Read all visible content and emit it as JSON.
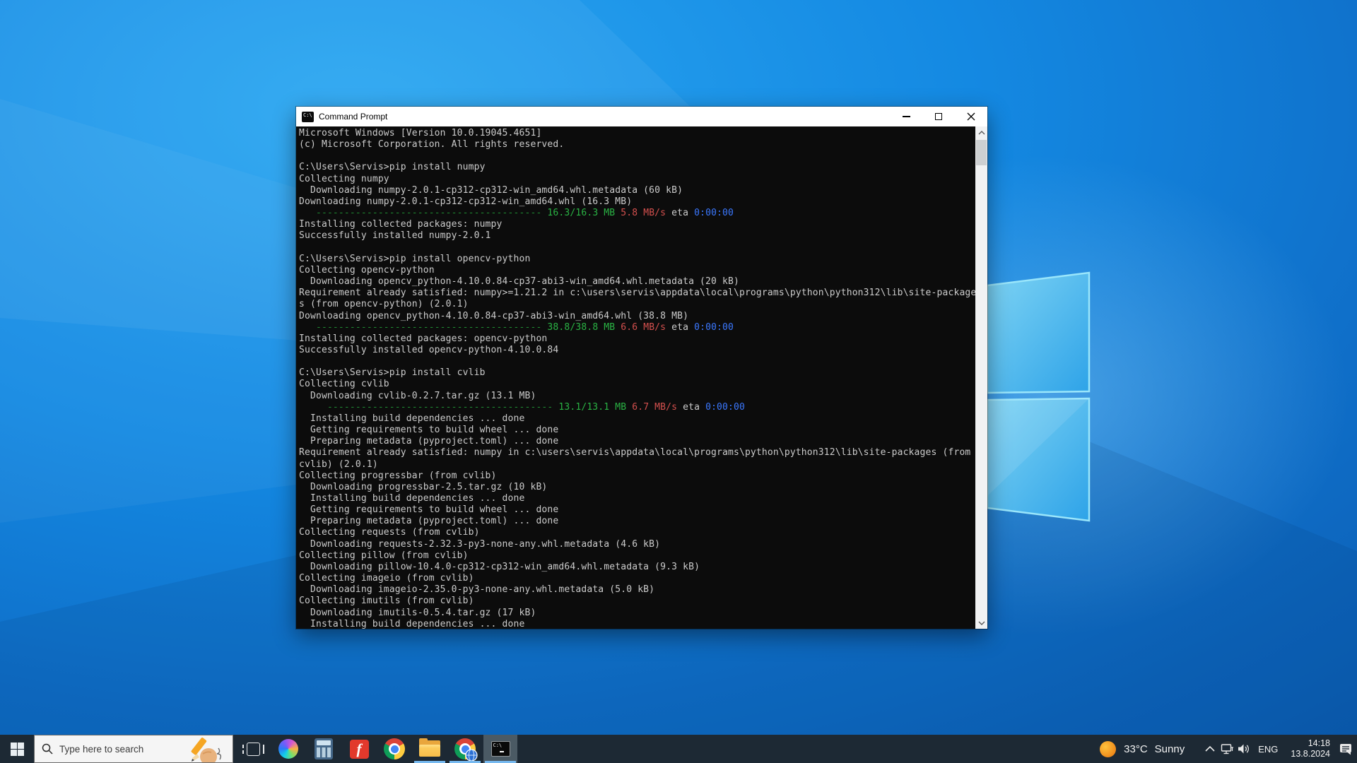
{
  "window": {
    "title": "Command Prompt",
    "icon_label": "C:\\"
  },
  "terminal": {
    "lines": [
      "Microsoft Windows [Version 10.0.19045.4651]",
      "(c) Microsoft Corporation. All rights reserved.",
      "",
      "C:\\Users\\Servis>pip install numpy",
      "Collecting numpy",
      "  Downloading numpy-2.0.1-cp312-cp312-win_amd64.whl.metadata (60 kB)",
      "Downloading numpy-2.0.1-cp312-cp312-win_amd64.whl (16.3 MB)",
      [
        {
          "t": "   ",
          "c": "d"
        },
        {
          "t": "---------------------------------------- ",
          "c": "gd"
        },
        {
          "t": "16.3/16.3 MB",
          "c": "g"
        },
        {
          "t": " ",
          "c": "d"
        },
        {
          "t": "5.8 MB/s",
          "c": "r"
        },
        {
          "t": " eta ",
          "c": "d"
        },
        {
          "t": "0:00:00",
          "c": "b"
        }
      ],
      "Installing collected packages: numpy",
      "Successfully installed numpy-2.0.1",
      "",
      "C:\\Users\\Servis>pip install opencv-python",
      "Collecting opencv-python",
      "  Downloading opencv_python-4.10.0.84-cp37-abi3-win_amd64.whl.metadata (20 kB)",
      "Requirement already satisfied: numpy>=1.21.2 in c:\\users\\servis\\appdata\\local\\programs\\python\\python312\\lib\\site-package",
      "s (from opencv-python) (2.0.1)",
      "Downloading opencv_python-4.10.0.84-cp37-abi3-win_amd64.whl (38.8 MB)",
      [
        {
          "t": "   ",
          "c": "d"
        },
        {
          "t": "---------------------------------------- ",
          "c": "gd"
        },
        {
          "t": "38.8/38.8 MB",
          "c": "g"
        },
        {
          "t": " ",
          "c": "d"
        },
        {
          "t": "6.6 MB/s",
          "c": "r"
        },
        {
          "t": " eta ",
          "c": "d"
        },
        {
          "t": "0:00:00",
          "c": "b"
        }
      ],
      "Installing collected packages: opencv-python",
      "Successfully installed opencv-python-4.10.0.84",
      "",
      "C:\\Users\\Servis>pip install cvlib",
      "Collecting cvlib",
      "  Downloading cvlib-0.2.7.tar.gz (13.1 MB)",
      [
        {
          "t": "     ",
          "c": "d"
        },
        {
          "t": "---------------------------------------- ",
          "c": "gd"
        },
        {
          "t": "13.1/13.1 MB",
          "c": "g"
        },
        {
          "t": " ",
          "c": "d"
        },
        {
          "t": "6.7 MB/s",
          "c": "r"
        },
        {
          "t": " eta ",
          "c": "d"
        },
        {
          "t": "0:00:00",
          "c": "b"
        }
      ],
      "  Installing build dependencies ... done",
      "  Getting requirements to build wheel ... done",
      "  Preparing metadata (pyproject.toml) ... done",
      "Requirement already satisfied: numpy in c:\\users\\servis\\appdata\\local\\programs\\python\\python312\\lib\\site-packages (from",
      "cvlib) (2.0.1)",
      "Collecting progressbar (from cvlib)",
      "  Downloading progressbar-2.5.tar.gz (10 kB)",
      "  Installing build dependencies ... done",
      "  Getting requirements to build wheel ... done",
      "  Preparing metadata (pyproject.toml) ... done",
      "Collecting requests (from cvlib)",
      "  Downloading requests-2.32.3-py3-none-any.whl.metadata (4.6 kB)",
      "Collecting pillow (from cvlib)",
      "  Downloading pillow-10.4.0-cp312-cp312-win_amd64.whl.metadata (9.3 kB)",
      "Collecting imageio (from cvlib)",
      "  Downloading imageio-2.35.0-py3-none-any.whl.metadata (5.0 kB)",
      "Collecting imutils (from cvlib)",
      "  Downloading imutils-0.5.4.tar.gz (17 kB)",
      "  Installing build dependencies ... done"
    ]
  },
  "taskbar": {
    "search": {
      "placeholder": "Type here to search"
    },
    "apps": [
      "start",
      "search",
      "task-view",
      "copilot",
      "calculator",
      "red-f-app",
      "chrome",
      "file-explorer",
      "chrome-globe-app",
      "command-prompt"
    ],
    "tray": {
      "weather_temp": "33°C",
      "weather_condition": "Sunny",
      "language": "ENG",
      "time": "14:18",
      "date": "13.8.2024"
    }
  },
  "colors": {
    "term_background": "#0c0c0c",
    "term_foreground": "#cccccc",
    "term_green": "#2ab344",
    "term_red": "#d4504e",
    "term_blue": "#3b78ff",
    "taskbar": "#1d2934",
    "accent_underline": "#76b9f0"
  }
}
